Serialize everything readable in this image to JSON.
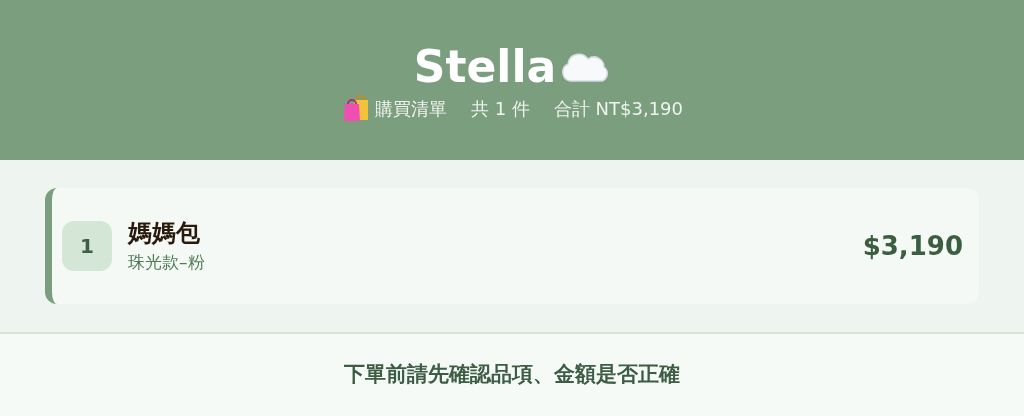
{
  "header": {
    "title": "Stella",
    "list_label": "購買清單",
    "count": "共 1 件",
    "total": "合計 NT$3,190"
  },
  "items": [
    {
      "index": "1",
      "name": "媽媽包",
      "variant": "珠光款–粉",
      "price": "$3,190"
    }
  ],
  "footer": {
    "notice": "下單前請先確認品項、金額是否正確"
  }
}
